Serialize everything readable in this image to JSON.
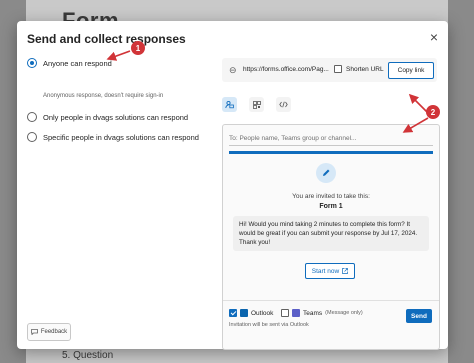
{
  "background": {
    "title": "Form",
    "question": "5. Question"
  },
  "dialog": {
    "title": "Send and collect responses",
    "close_glyph": "×",
    "options": [
      {
        "label": "Anyone can respond",
        "selected": true
      },
      {
        "label": "Only people in dvags solutions can respond",
        "selected": false
      },
      {
        "label": "Specific people in dvags solutions can respond",
        "selected": false
      }
    ],
    "anyone_sublabel": "Anonymous response, doesn't require sign-in",
    "feedback_label": "Feedback",
    "link": {
      "url": "https://forms.office.com/Pag...",
      "shorten_label": "Shorten URL",
      "shorten_checked": false,
      "copy_label": "Copy link"
    },
    "share_tabs": [
      "email",
      "qr-code",
      "embed-code"
    ],
    "email": {
      "to_placeholder": "To: People name, Teams group or channel...",
      "invited_text": "You are invited to take this:",
      "form_name": "Form 1",
      "message": "Hi! Would you mind taking 2 minutes to complete this form? It would be great if you can submit your response by Jul 17, 2024. Thank you!",
      "start_label": "Start now",
      "outlook_label": "Outlook",
      "outlook_checked": true,
      "teams_label": "Teams",
      "teams_note": "(Message only)",
      "teams_checked": false,
      "sent_via": "Invitation will be sent via Outlook",
      "send_label": "Send"
    }
  },
  "markers": [
    "1",
    "2"
  ],
  "colors": {
    "accent": "#0f6cbd",
    "marker": "#d13438"
  }
}
